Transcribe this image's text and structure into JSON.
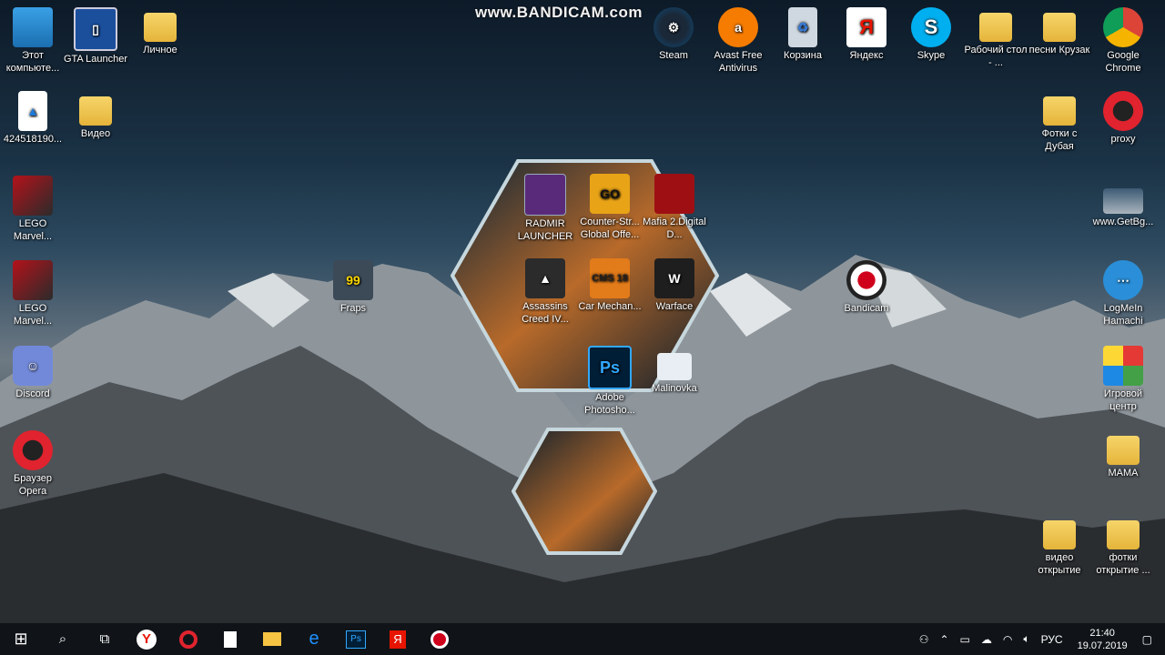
{
  "watermark": "www.BANDICAM.com",
  "desktop_icons": {
    "this_pc": "Этот компьюте...",
    "gta_launcher": "GTA Launcher",
    "lichnoe": "Личное",
    "steam": "Steam",
    "avast": "Avast Free Antivirus",
    "recycle_bin": "Корзина",
    "yandex": "Яндекс",
    "skype": "Skype",
    "workdesk": "Рабочий стол - ...",
    "songs": "песни Крузак",
    "chrome": "Google Chrome",
    "image_file": "424518190...",
    "video": "Видео",
    "dubai_photos": "Фотки с Дубая",
    "proxy": "proxy",
    "getbg": "www.GetBg...",
    "lego1": "LEGO Marvel...",
    "lego2": "LEGO Marvel...",
    "fraps": "Fraps",
    "bandicam": "Bandicam",
    "logmein": "LogMeIn Hamachi",
    "discord": "Discord",
    "game_center": "Игровой центр",
    "opera_browser": "Браузер Opera",
    "mama": "MAMA",
    "video_opening": "видео открытие",
    "photo_opening": "фотки открытие ..."
  },
  "hex_group": {
    "radmir": "RADMIR LAUNCHER",
    "csgo": "Counter-Str... Global Offe...",
    "mafia": "Mafia 2.Digital D...",
    "assassins": "Assassins Creed IV...",
    "car_mech": "Car Mechan...",
    "warface": "Warface",
    "photoshop": "Adobe Photosho...",
    "malinovka": "Malinovka",
    "fraps_badge": "99",
    "csgo_badge": "GO",
    "cms_badge": "CMS 18",
    "ps_badge": "Ps"
  },
  "taskbar": {
    "language": "РУС",
    "time": "21:40",
    "date": "19.07.2019"
  }
}
